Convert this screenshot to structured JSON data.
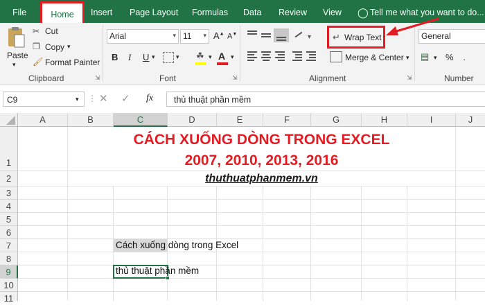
{
  "tabs": {
    "file": "File",
    "home": "Home",
    "insert": "Insert",
    "page_layout": "Page Layout",
    "formulas": "Formulas",
    "data": "Data",
    "review": "Review",
    "view": "View",
    "tell_me": "Tell me what you want to do..."
  },
  "clipboard": {
    "paste": "Paste",
    "cut": "Cut",
    "copy": "Copy",
    "format_painter": "Format Painter",
    "label": "Clipboard"
  },
  "font": {
    "name": "Arial",
    "size": "11",
    "bold": "B",
    "italic": "I",
    "underline": "U",
    "label": "Font",
    "fill_color": "#ffff00",
    "font_color": "#e31b23"
  },
  "alignment": {
    "wrap_text": "Wrap Text",
    "merge_center": "Merge & Center",
    "label": "Alignment"
  },
  "number": {
    "format": "General",
    "percent": "%",
    "label": "Number"
  },
  "formula_bar": {
    "name_box": "C9",
    "fx": "fx",
    "content": "thủ thuật phần mềm"
  },
  "columns": [
    "A",
    "B",
    "C",
    "D",
    "E",
    "F",
    "G",
    "H",
    "I",
    "J"
  ],
  "rows": [
    "1",
    "2",
    "3",
    "4",
    "5",
    "6",
    "7",
    "8",
    "9",
    "10",
    "11"
  ],
  "cells": {
    "title_line1": "CÁCH XUỐNG DÒNG TRONG EXCEL",
    "title_line2": "2007, 2010, 2013, 2016",
    "subtitle": "thuthuatphanmem.vn",
    "c7": "Cách xuống dòng trong Excel",
    "c9": "thủ thuật phần mềm"
  },
  "colors": {
    "accent": "#217346",
    "highlight": "#e31b23",
    "title_red": "#e31b23",
    "selected_fill": "#d9d9d9"
  }
}
